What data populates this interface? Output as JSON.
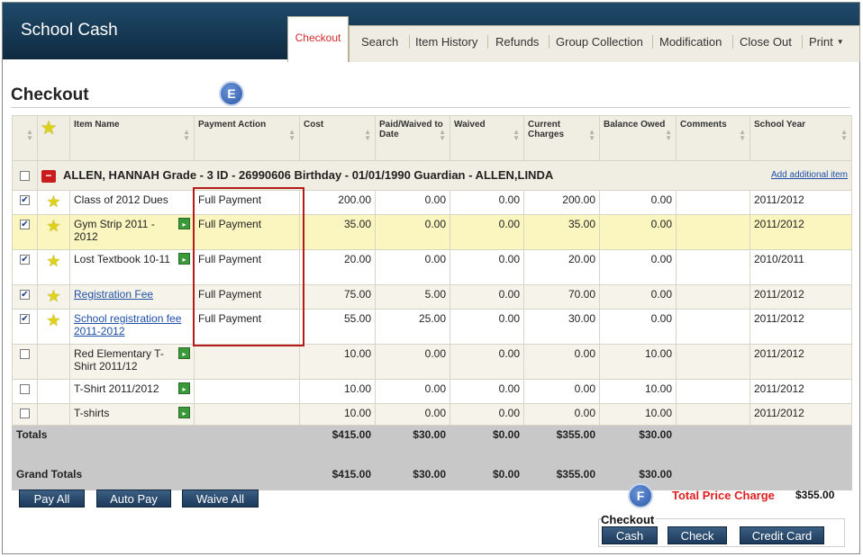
{
  "app": {
    "title": "School Cash"
  },
  "nav": {
    "active_tab": "Checkout",
    "items": [
      "Search",
      "Item History",
      "Refunds",
      "Group Collection",
      "Modification",
      "Close Out",
      "Print"
    ]
  },
  "page": {
    "title": "Checkout",
    "callout_e": "E",
    "callout_f": "F"
  },
  "table": {
    "headers": {
      "item_name": "Item Name",
      "payment_action": "Payment Action",
      "cost": "Cost",
      "paid_waived": "Paid/Waived to Date",
      "waived": "Waived",
      "current_charges": "Current Charges",
      "balance_owed": "Balance Owed",
      "comments": "Comments",
      "school_year": "School Year"
    },
    "group": {
      "label": "ALLEN, HANNAH Grade - 3 ID - 26990606 Birthday - 01/01/1990 Guardian - ALLEN,LINDA",
      "add_link": "Add additional item"
    },
    "rows": [
      {
        "item": "Class of 2012 Dues",
        "action": "Full Payment",
        "cost": "200.00",
        "paid": "0.00",
        "waived": "0.00",
        "current": "200.00",
        "balance": "0.00",
        "comments": "",
        "year": "2011/2012",
        "checked": true
      },
      {
        "item": "Gym Strip 2011 - 2012",
        "action": "Full Payment",
        "cost": "35.00",
        "paid": "0.00",
        "waived": "0.00",
        "current": "35.00",
        "balance": "0.00",
        "comments": "",
        "year": "2011/2012",
        "checked": true
      },
      {
        "item": "Lost Textbook 10-11",
        "action": "Full Payment",
        "cost": "20.00",
        "paid": "0.00",
        "waived": "0.00",
        "current": "20.00",
        "balance": "0.00",
        "comments": "",
        "year": "2010/2011",
        "checked": true
      },
      {
        "item": "Registration Fee",
        "action": "Full Payment",
        "cost": "75.00",
        "paid": "5.00",
        "waived": "0.00",
        "current": "70.00",
        "balance": "0.00",
        "comments": "",
        "year": "2011/2012",
        "checked": true
      },
      {
        "item": "School registration fee 2011-2012",
        "action": "Full Payment",
        "cost": "55.00",
        "paid": "25.00",
        "waived": "0.00",
        "current": "30.00",
        "balance": "0.00",
        "comments": "",
        "year": "2011/2012",
        "checked": true
      },
      {
        "item": "Red Elementary T-Shirt 2011/12",
        "action": "",
        "cost": "10.00",
        "paid": "0.00",
        "waived": "0.00",
        "current": "0.00",
        "balance": "10.00",
        "comments": "",
        "year": "2011/2012",
        "checked": false
      },
      {
        "item": "T-Shirt 2011/2012",
        "action": "",
        "cost": "10.00",
        "paid": "0.00",
        "waived": "0.00",
        "current": "0.00",
        "balance": "10.00",
        "comments": "",
        "year": "2011/2012",
        "checked": false
      },
      {
        "item": "T-shirts",
        "action": "",
        "cost": "10.00",
        "paid": "0.00",
        "waived": "0.00",
        "current": "0.00",
        "balance": "10.00",
        "comments": "",
        "year": "2011/2012",
        "checked": false
      }
    ],
    "totals": {
      "label": "Totals",
      "cost": "$415.00",
      "paid": "$30.00",
      "waived": "$0.00",
      "current": "$355.00",
      "balance": "$30.00"
    },
    "grand_totals": {
      "label": "Grand Totals",
      "cost": "$415.00",
      "paid": "$30.00",
      "waived": "$0.00",
      "current": "$355.00",
      "balance": "$30.00"
    }
  },
  "actions": {
    "pay_all": "Pay All",
    "auto_pay": "Auto Pay",
    "waive_all": "Waive All"
  },
  "summary": {
    "total_label": "Total Price Charge",
    "total_value": "$355.00"
  },
  "checkout": {
    "label": "Checkout",
    "cash": "Cash",
    "check": "Check",
    "credit_card": "Credit Card"
  },
  "icons": {
    "star": "star-icon",
    "minus": "collapse-minus-icon",
    "item": "item-detail-icon",
    "caret": "chevron-down-icon"
  },
  "colors": {
    "header_bg": "#1f4a6a",
    "active_tab": "#d32b2b",
    "highlight_row": "#fbf5bf",
    "total_label": "#e02020",
    "button_bg": "#2a4a6e",
    "callout_bg": "#2e5ba8"
  }
}
